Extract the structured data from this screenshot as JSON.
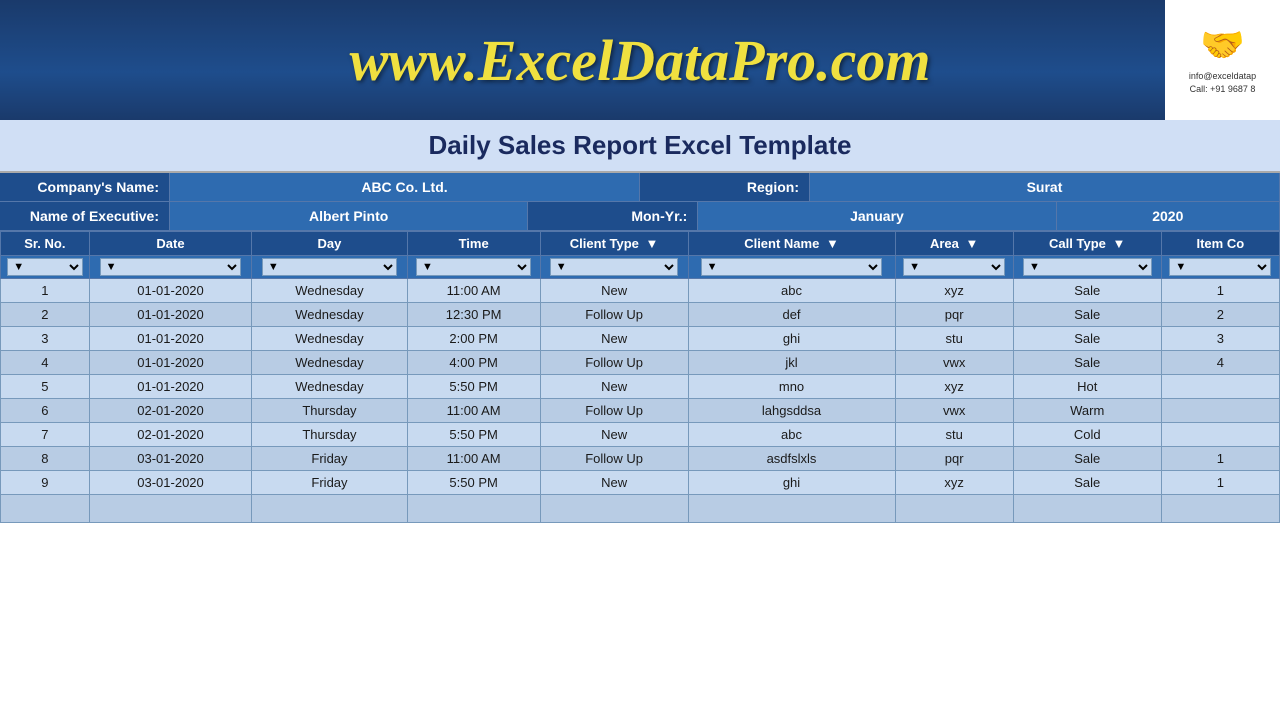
{
  "header": {
    "site_url": "www.ExcelDataPro.com",
    "title": "Daily Sales Report Excel Template",
    "logo_contact_line1": "info@exceldatap",
    "logo_contact_line2": "Call: +91 9687 8"
  },
  "info": {
    "company_label": "Company's Name:",
    "company_value": "ABC Co. Ltd.",
    "region_label": "Region:",
    "region_value": "Surat",
    "executive_label": "Name of Executive:",
    "executive_value": "Albert Pinto",
    "monyr_label": "Mon-Yr.:",
    "monyr_value": "January",
    "year_value": "2020"
  },
  "columns": {
    "sr_no": "Sr. No.",
    "date": "Date",
    "day": "Day",
    "time": "Time",
    "client_type": "Client Type",
    "client_name": "Client Name",
    "area": "Area",
    "call_type": "Call Type",
    "item_co": "Item Co"
  },
  "rows": [
    {
      "sr": 1,
      "date": "01-01-2020",
      "day": "Wednesday",
      "time": "11:00 AM",
      "client_type": "New",
      "client_name": "abc",
      "area": "xyz",
      "call_type": "Sale",
      "item_co": "1"
    },
    {
      "sr": 2,
      "date": "01-01-2020",
      "day": "Wednesday",
      "time": "12:30 PM",
      "client_type": "Follow Up",
      "client_name": "def",
      "area": "pqr",
      "call_type": "Sale",
      "item_co": "2"
    },
    {
      "sr": 3,
      "date": "01-01-2020",
      "day": "Wednesday",
      "time": "2:00 PM",
      "client_type": "New",
      "client_name": "ghi",
      "area": "stu",
      "call_type": "Sale",
      "item_co": "3"
    },
    {
      "sr": 4,
      "date": "01-01-2020",
      "day": "Wednesday",
      "time": "4:00 PM",
      "client_type": "Follow Up",
      "client_name": "jkl",
      "area": "vwx",
      "call_type": "Sale",
      "item_co": "4"
    },
    {
      "sr": 5,
      "date": "01-01-2020",
      "day": "Wednesday",
      "time": "5:50 PM",
      "client_type": "New",
      "client_name": "mno",
      "area": "xyz",
      "call_type": "Hot",
      "item_co": ""
    },
    {
      "sr": 6,
      "date": "02-01-2020",
      "day": "Thursday",
      "time": "11:00 AM",
      "client_type": "Follow Up",
      "client_name": "lahgsddsa",
      "area": "vwx",
      "call_type": "Warm",
      "item_co": ""
    },
    {
      "sr": 7,
      "date": "02-01-2020",
      "day": "Thursday",
      "time": "5:50 PM",
      "client_type": "New",
      "client_name": "abc",
      "area": "stu",
      "call_type": "Cold",
      "item_co": ""
    },
    {
      "sr": 8,
      "date": "03-01-2020",
      "day": "Friday",
      "time": "11:00 AM",
      "client_type": "Follow Up",
      "client_name": "asdfslxls",
      "area": "pqr",
      "call_type": "Sale",
      "item_co": "1"
    },
    {
      "sr": 9,
      "date": "03-01-2020",
      "day": "Friday",
      "time": "5:50 PM",
      "client_type": "New",
      "client_name": "ghi",
      "area": "xyz",
      "call_type": "Sale",
      "item_co": "1"
    }
  ]
}
